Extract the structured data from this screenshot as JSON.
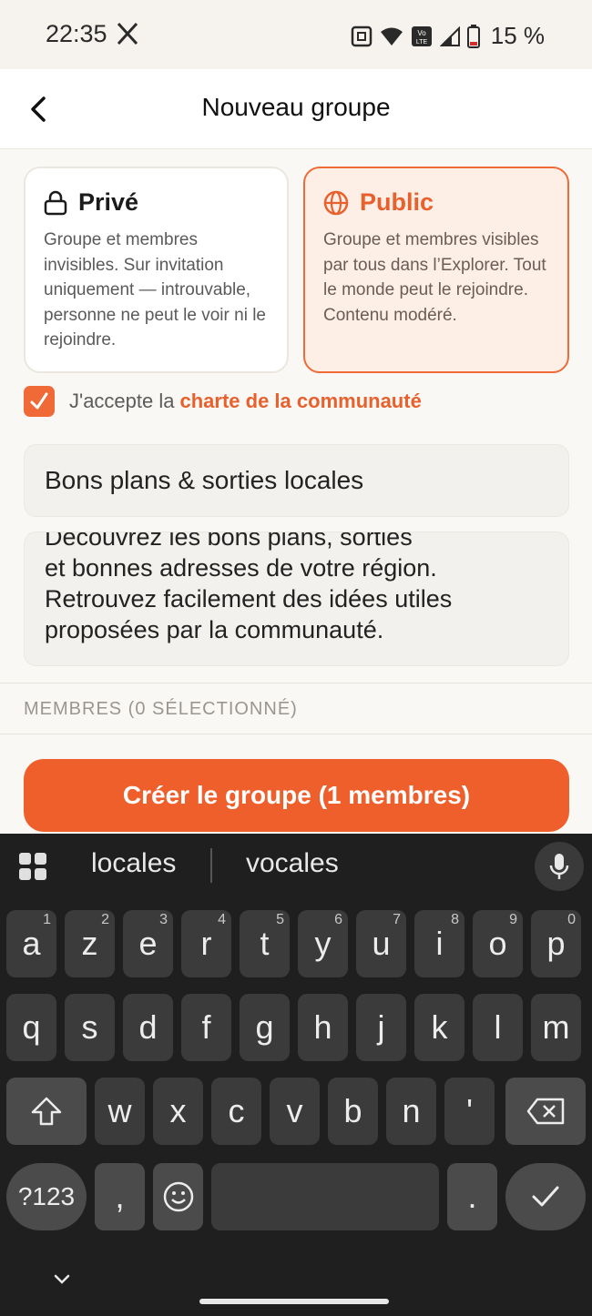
{
  "status_bar": {
    "time": "22:35",
    "battery": "15 %",
    "icons": [
      "x-logo-icon",
      "nfc-icon",
      "wifi-icon",
      "volte-icon",
      "signal-icon",
      "battery-icon"
    ]
  },
  "header": {
    "title": "Nouveau groupe",
    "back_icon": "chevron-left-icon"
  },
  "privacy": {
    "private": {
      "title": "Privé",
      "icon": "lock-icon",
      "description": "Groupe et membres invisibles. Sur invitation uniquement — introuvable, personne ne peut le voir ni le rejoindre."
    },
    "public": {
      "title": "Public",
      "icon": "globe-icon",
      "description": "Groupe et membres visibles par tous dans l’Explorer. Tout le monde peut le rejoindre. Contenu modéré.",
      "selected": true
    }
  },
  "agreement": {
    "text": "J'accepte la",
    "link": "charte de la communauté",
    "checked": true
  },
  "form": {
    "name_value": "Bons plans & sorties locales",
    "description_lines": [
      "Découvrez les bons plans, sorties",
      "et bonnes adresses de votre région.",
      "Retrouvez facilement des idées utiles",
      "proposées par la communauté."
    ]
  },
  "members": {
    "label": "MEMBRES (0 SÉLECTIONNÉ)"
  },
  "create_button": {
    "label": "Créer le groupe (1 membres)"
  },
  "colors": {
    "accent": "#ef5f2b",
    "accent_light": "#fdeee6",
    "keyboard_bg": "#1f1f1f",
    "key_bg": "#3b3b3b"
  },
  "keyboard": {
    "suggestions": [
      "locales",
      "vocales"
    ],
    "row1": [
      {
        "k": "a",
        "h": "1"
      },
      {
        "k": "z",
        "h": "2"
      },
      {
        "k": "e",
        "h": "3"
      },
      {
        "k": "r",
        "h": "4"
      },
      {
        "k": "t",
        "h": "5"
      },
      {
        "k": "y",
        "h": "6"
      },
      {
        "k": "u",
        "h": "7"
      },
      {
        "k": "i",
        "h": "8"
      },
      {
        "k": "o",
        "h": "9"
      },
      {
        "k": "p",
        "h": "0"
      }
    ],
    "row2": [
      "q",
      "s",
      "d",
      "f",
      "g",
      "h",
      "j",
      "k",
      "l",
      "m"
    ],
    "row3": [
      "w",
      "x",
      "c",
      "v",
      "b",
      "n",
      "'"
    ],
    "symbols_label": "?123",
    "comma": ",",
    "period": "."
  }
}
